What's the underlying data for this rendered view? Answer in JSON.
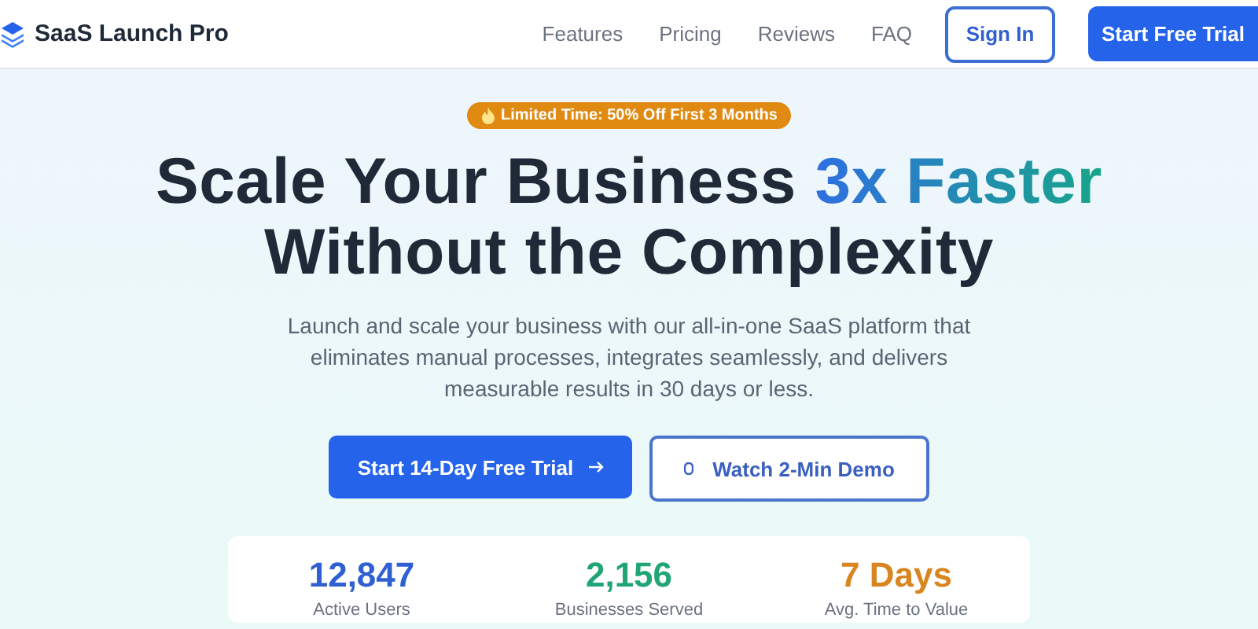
{
  "brand": {
    "name": "SaaS Launch Pro"
  },
  "nav": {
    "links": [
      "Features",
      "Pricing",
      "Reviews",
      "FAQ"
    ],
    "sign_in": "Sign In",
    "cta": "Start Free Trial"
  },
  "hero": {
    "badge": "Limited Time: 50% Off First 3 Months",
    "headline": {
      "lead": "Scale Your Business",
      "highlight": "3x Faster",
      "line_2": "Without the Complexity"
    },
    "subtitle": "Launch and scale your business with our all-in-one SaaS platform that eliminates manual processes, integrates seamlessly, and delivers measurable results in 30 days or less.",
    "primary_button": "Start 14-Day Free Trial",
    "secondary_button": "Watch 2-Min Demo"
  },
  "stats": [
    {
      "value": "12,847",
      "label": "Active Users",
      "color": "#2f5fd0"
    },
    {
      "value": "2,156",
      "label": "Businesses Served",
      "color": "#22a574"
    },
    {
      "value": "7 Days",
      "label": "Avg. Time to Value",
      "color": "#d98520"
    }
  ]
}
